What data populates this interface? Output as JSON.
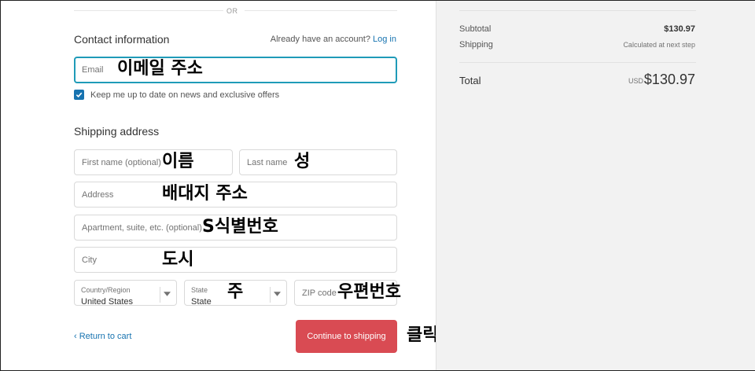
{
  "divider": {
    "or_text": "OR"
  },
  "contact": {
    "title": "Contact information",
    "have_account": "Already have an account?",
    "login": "Log in",
    "email_placeholder": "Email",
    "email_annotation": "이메일 주소",
    "newsletter_label": "Keep me up to date on news and exclusive offers",
    "newsletter_checked": true
  },
  "shipping": {
    "title": "Shipping address",
    "first_name": {
      "placeholder": "First name (optional)",
      "annotation": "이름"
    },
    "last_name": {
      "placeholder": "Last name",
      "annotation": "성"
    },
    "address": {
      "placeholder": "Address",
      "annotation": "배대지 주소"
    },
    "apartment": {
      "placeholder": "Apartment, suite, etc. (optional)",
      "annotation": "S식별번호"
    },
    "city": {
      "placeholder": "City",
      "annotation": "도시"
    },
    "country": {
      "label": "Country/Region",
      "value": "United States"
    },
    "state": {
      "label": "State",
      "value": "State",
      "annotation": "주"
    },
    "zip": {
      "placeholder": "ZIP code",
      "annotation": "우편번호"
    }
  },
  "footer": {
    "return_label": "Return to cart",
    "continue_label": "Continue to shipping",
    "continue_annotation": "클릭"
  },
  "summary": {
    "subtotal_label": "Subtotal",
    "subtotal_value": "$130.97",
    "shipping_label": "Shipping",
    "shipping_value": "Calculated at next step",
    "total_label": "Total",
    "currency": "USD",
    "total_value": "$130.97"
  },
  "colors": {
    "accent": "#1773b0",
    "focus": "#1f9bb8",
    "button": "#d94b53",
    "sidebar_bg": "#f2f2f2"
  }
}
